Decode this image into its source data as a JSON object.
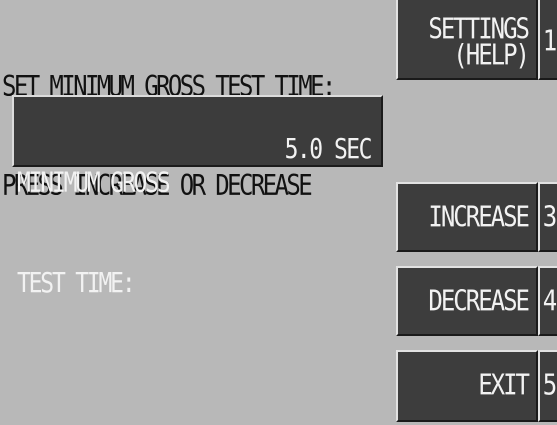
{
  "prompt": {
    "line1": "SET MINIMUM GROSS TEST TIME:",
    "line2": "PRESS INCREASE OR DECREASE"
  },
  "parameter": {
    "label_line1": "MINIMUM GROSS",
    "label_line2": "TEST TIME:",
    "value": "5.0 SEC"
  },
  "function_keys": [
    {
      "label_line1": "SETTINGS",
      "label_line2": "(HELP)",
      "number": "1"
    },
    {
      "label": "INCREASE",
      "number": "3"
    },
    {
      "label": "DECREASE",
      "number": "4"
    },
    {
      "label": "EXIT",
      "number": "5"
    }
  ],
  "colors": {
    "background": "#b8b8b8",
    "button": "#3d3d3d",
    "button_text": "#f2f2f2"
  }
}
